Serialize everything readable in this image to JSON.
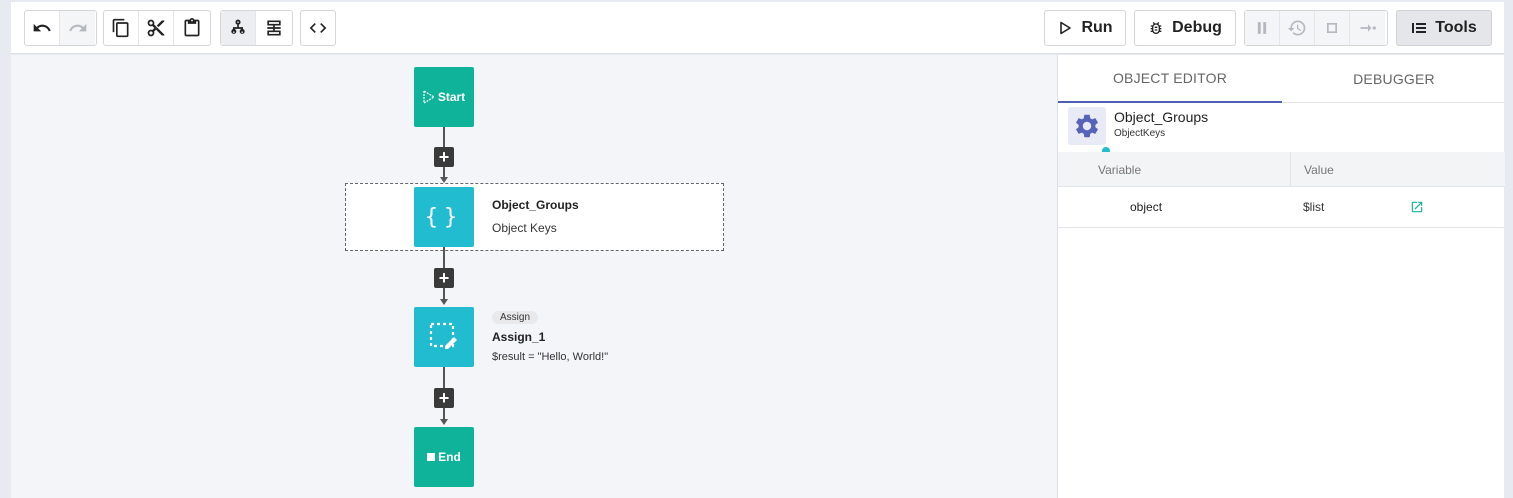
{
  "toolbar": {
    "run_label": "Run",
    "debug_label": "Debug",
    "tools_label": "Tools",
    "icons": [
      "undo-icon",
      "redo-icon",
      "copy-icon",
      "cut-icon",
      "paste-icon",
      "tree-layout-icon",
      "stack-layout-icon",
      "code-icon",
      "pause-icon",
      "step-back-icon",
      "stop-icon",
      "step-over-icon"
    ]
  },
  "flow": {
    "start_label": "Start",
    "end_label": "End",
    "nodes": [
      {
        "title": "Object_Groups",
        "subtitle": "Object Keys"
      },
      {
        "tag": "Assign",
        "title": "Assign_1",
        "subtitle": "$result = \"Hello, World!\""
      }
    ]
  },
  "panel": {
    "tabs": [
      {
        "label": "OBJECT EDITOR",
        "active": true
      },
      {
        "label": "DEBUGGER",
        "active": false
      }
    ],
    "object": {
      "name": "Object_Groups",
      "type": "ObjectKeys"
    },
    "table": {
      "headers": [
        "Variable",
        "Value"
      ],
      "rows": [
        {
          "variable": "object",
          "value": "$list"
        }
      ]
    }
  },
  "colors": {
    "node_green": "#0fb39a",
    "node_cyan": "#22bcd1",
    "accent": "#4f5fb8"
  }
}
